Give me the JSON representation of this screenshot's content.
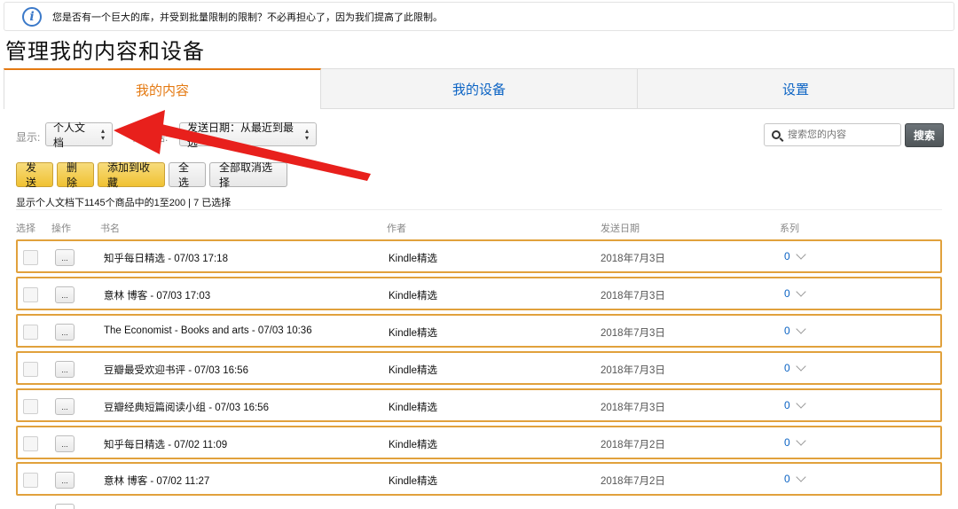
{
  "notice": {
    "text": "您是否有一个巨大的库，并受到批量限制的限制？不必再担心了，因为我们提高了此限制。",
    "icon": "info-icon"
  },
  "page_title": "管理我的内容和设备",
  "tabs": [
    {
      "label": "我的内容",
      "active": true
    },
    {
      "label": "我的设备",
      "active": false
    },
    {
      "label": "设置",
      "active": false
    }
  ],
  "filters": {
    "show_label": "显示:",
    "show_value": "个人文档",
    "sort_label": "序依据:",
    "sort_value": "发送日期：从最近到最远",
    "search_placeholder": "搜索您的内容",
    "search_button": "搜索"
  },
  "actions": {
    "send": "发送",
    "delete": "删除",
    "add_to_collection": "添加到收藏",
    "select_all": "全选",
    "deselect_all": "全部取消选择"
  },
  "count_text": "显示个人文档下1145个商品中的1至200 | 7 已选择",
  "columns": {
    "select": "选择",
    "action": "操作",
    "title": "书名",
    "author": "作者",
    "date": "发送日期",
    "series": "系列"
  },
  "rows": [
    {
      "more": "...",
      "title": "知乎每日精选 - 07/03 17:18",
      "author": "Kindle精选",
      "date": "2018年7月3日",
      "series": "0"
    },
    {
      "more": "...",
      "title": "意林 博客 - 07/03 17:03",
      "author": "Kindle精选",
      "date": "2018年7月3日",
      "series": "0"
    },
    {
      "more": "...",
      "title": "The Economist - Books and arts - 07/03 10:36",
      "author": "Kindle精选",
      "date": "2018年7月3日",
      "series": "0"
    },
    {
      "more": "...",
      "title": "豆瓣最受欢迎书评 - 07/03 16:56",
      "author": "Kindle精选",
      "date": "2018年7月3日",
      "series": "0"
    },
    {
      "more": "...",
      "title": "豆瓣经典短篇阅读小组 - 07/03 16:56",
      "author": "Kindle精选",
      "date": "2018年7月3日",
      "series": "0"
    },
    {
      "more": "...",
      "title": "知乎每日精选 - 07/02 11:09",
      "author": "Kindle精选",
      "date": "2018年7月2日",
      "series": "0"
    },
    {
      "more": "...",
      "title": "意林 博客 - 07/02 11:27",
      "author": "Kindle精选",
      "date": "2018年7月2日",
      "series": "0"
    }
  ],
  "colors": {
    "accent": "#e47911",
    "link": "#0b63c4",
    "row_border": "#e1a13c",
    "arrow": "#e8201c"
  }
}
